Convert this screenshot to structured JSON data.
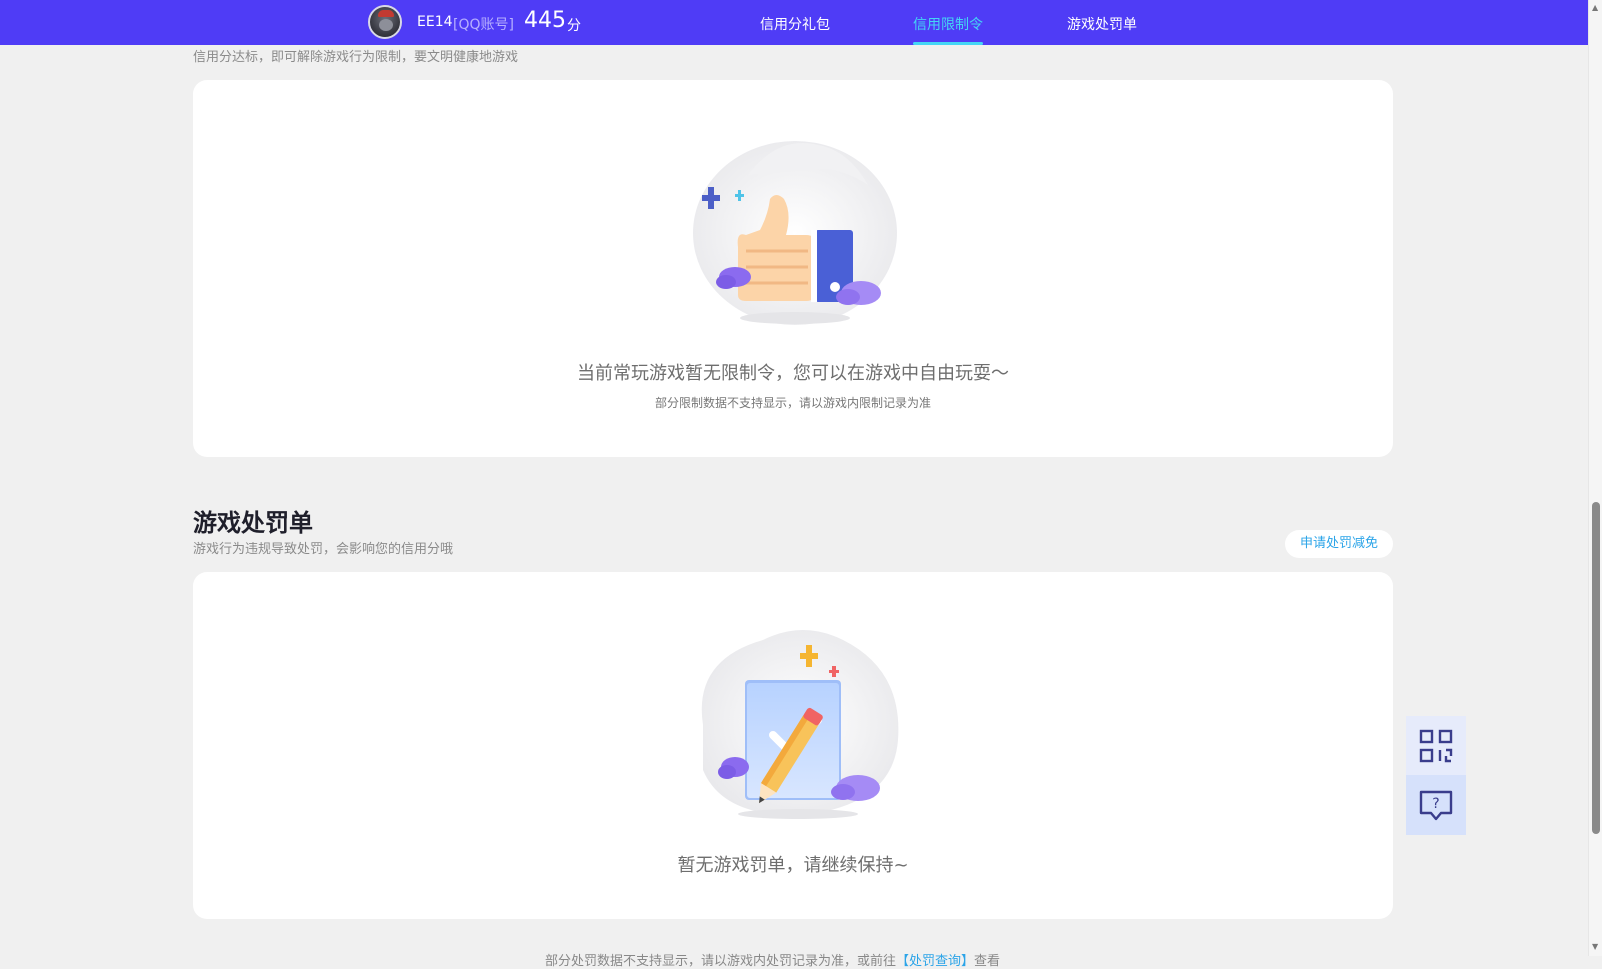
{
  "nav": {
    "username": "EE14",
    "account_type": "[QQ账号]",
    "score": "445",
    "score_unit": "分",
    "tabs": [
      {
        "label": "信用分礼包"
      },
      {
        "label": "信用限制令"
      },
      {
        "label": "游戏处罚单"
      }
    ]
  },
  "restrictions": {
    "description": "信用分达标，即可解除游戏行为限制，要文明健康地游戏",
    "empty_message": "当前常玩游戏暂无限制令，您可以在游戏中自由玩耍～",
    "empty_note": "部分限制数据不支持显示，请以游戏内限制记录为准"
  },
  "penalties": {
    "title": "游戏处罚单",
    "description": "游戏行为违规导致处罚，会影响您的信用分哦",
    "appeal_button": "申请处罚减免",
    "empty_message": "暂无游戏罚单，请继续保持~"
  },
  "footer": {
    "text_before": "部分处罚数据不支持显示，请以游戏内处罚记录为准，或前往",
    "link": "【处罚查询】",
    "text_after": "查看"
  },
  "floating": {
    "qr_icon": "qr-code-icon",
    "help_icon": "help-chat-icon"
  },
  "colors": {
    "nav_bg": "#4f3cf6",
    "active_tab": "#44d6f5",
    "link": "#2ba4e8"
  }
}
